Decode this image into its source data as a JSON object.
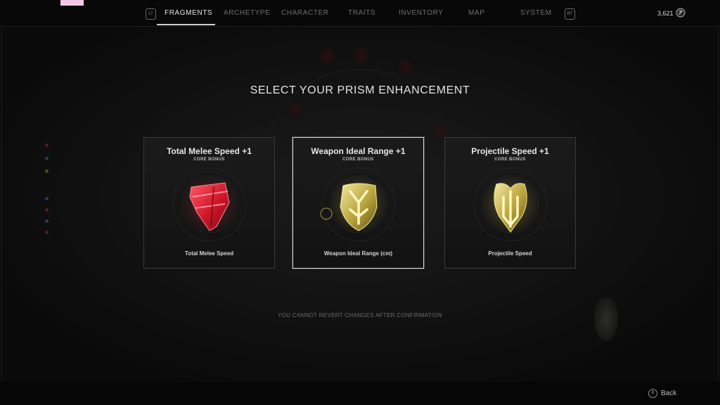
{
  "nav": {
    "left_bumper": "LT",
    "right_bumper": "RT",
    "tabs": [
      {
        "label": "FRAGMENTS",
        "active": true
      },
      {
        "label": "ARCHETYPE",
        "active": false
      },
      {
        "label": "CHARACTER",
        "active": false
      },
      {
        "label": "TRAITS",
        "active": false
      },
      {
        "label": "INVENTORY",
        "active": false
      },
      {
        "label": "MAP",
        "active": false
      },
      {
        "label": "SYSTEM",
        "active": false
      }
    ],
    "currency_amount": "3,621",
    "currency_icon": "scrap-icon"
  },
  "screen": {
    "title": "SELECT YOUR PRISM ENHANCEMENT",
    "warning": "YOU CANNOT REVERT CHANGES AFTER CONFIRMATION"
  },
  "cards": [
    {
      "title": "Total Melee Speed +1",
      "subtitle": "CORE BONUS",
      "stat": "Total Melee Speed",
      "icon": "red-fragment-icon",
      "color": "#e0283a",
      "selected": false
    },
    {
      "title": "Weapon Ideal Range +1",
      "subtitle": "CORE BONUS",
      "stat": "Weapon Ideal Range (cm)",
      "icon": "gold-fragment-range-icon",
      "color": "#d9c24a",
      "selected": true
    },
    {
      "title": "Projectile Speed +1",
      "subtitle": "CORE BONUS",
      "stat": "Projectile Speed",
      "icon": "gold-fragment-projectile-icon",
      "color": "#d9c24a",
      "selected": false
    }
  ],
  "footer": {
    "back_glyph": "B",
    "back_label": "Back"
  }
}
